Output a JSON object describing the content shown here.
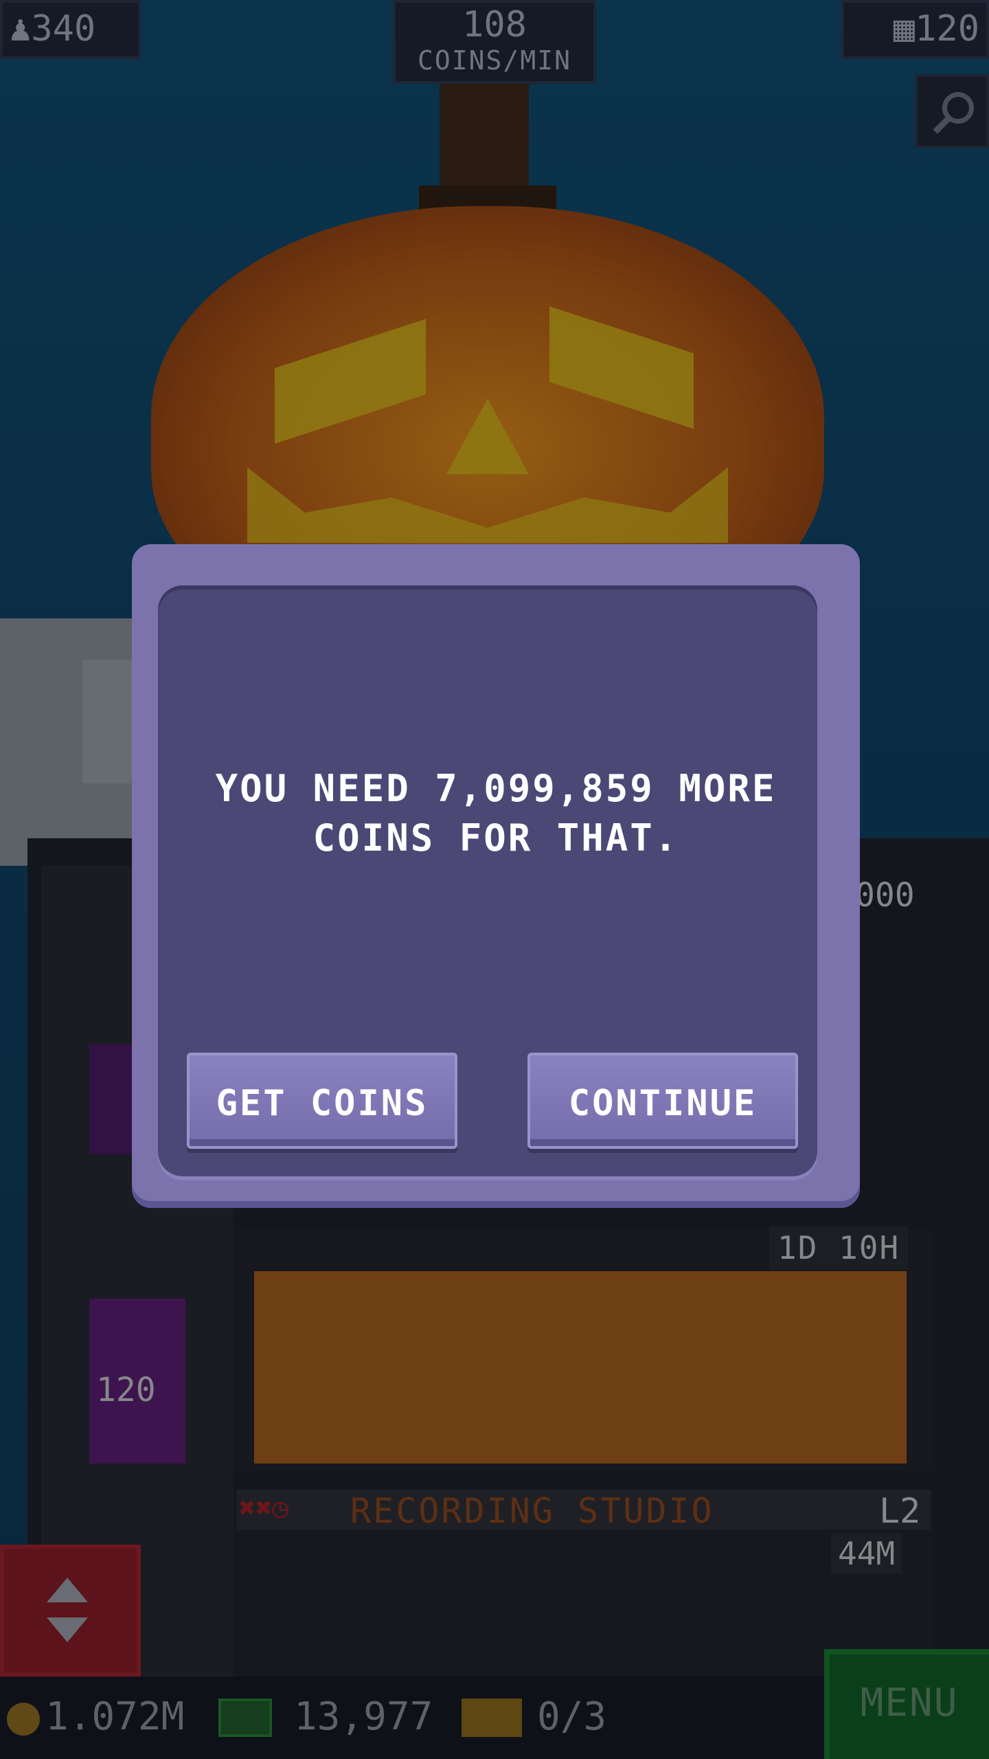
{
  "hud": {
    "population": "340",
    "coins_per_min_value": "108",
    "coins_per_min_unit": "COINS/MIN",
    "floors": "120"
  },
  "dialog": {
    "message_line1": "YOU NEED 7,099,859 MORE",
    "message_line2": "COINS FOR THAT.",
    "get_coins_label": "GET COINS",
    "continue_label": "CONTINUE"
  },
  "tower": {
    "side_floor_label": "120",
    "partial_value": "000",
    "construction_timer": "1D 10H",
    "recording_studio": {
      "name": "RECORDING STUDIO",
      "level": "L2",
      "time": "44M",
      "status_icons": [
        "x-icon",
        "x-icon",
        "clock-icon"
      ]
    }
  },
  "bottom_bar": {
    "coins": "1.072M",
    "bux": "13,977",
    "tickets": "0/3",
    "menu_label": "MENU"
  },
  "colors": {
    "dialog_outer": "#7c73ad",
    "dialog_inner": "#4b4876",
    "menu_green": "#0d5b1e",
    "elevator_red": "#8a1820"
  }
}
